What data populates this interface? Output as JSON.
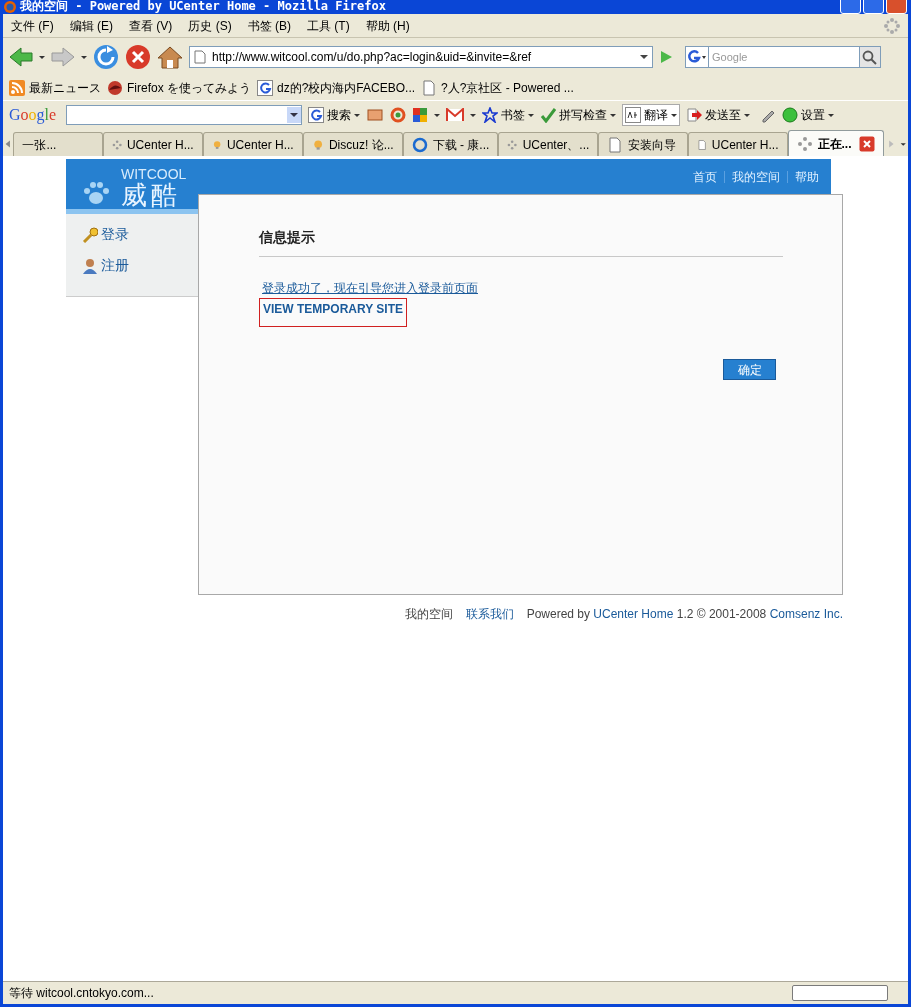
{
  "window": {
    "title": "我的空间 - Powered by UCenter Home - Mozilla Firefox"
  },
  "menu": [
    "文件 (F)",
    "编辑 (E)",
    "查看 (V)",
    "历史 (S)",
    "书签 (B)",
    "工具 (T)",
    "帮助 (H)"
  ],
  "nav": {
    "url": "http://www.witcool.com/u/do.php?ac=login&uid=&invite=&ref",
    "search_placeholder": "Google"
  },
  "bookmarks": [
    {
      "kind": "rss",
      "label": "最新ニュース"
    },
    {
      "kind": "firefox",
      "label": "Firefox を使ってみよう"
    },
    {
      "kind": "google",
      "label": "dz的?校内海内FACEBO..."
    },
    {
      "kind": "page",
      "label": "?人?京社区 - Powered ..."
    }
  ],
  "google_toolbar": {
    "logo": "Google",
    "buttons": [
      {
        "kind": "search",
        "label": "搜索"
      },
      {
        "kind": "bookmark",
        "label": "书签"
      },
      {
        "kind": "spell",
        "label": "拼写检查"
      },
      {
        "kind": "translate",
        "label": "翻译"
      },
      {
        "kind": "send",
        "label": "发送至"
      },
      {
        "kind": "settings",
        "label": "设置"
      }
    ]
  },
  "tabs": [
    {
      "label": "一张...",
      "selected": false,
      "kind": "plain"
    },
    {
      "label": "UCenter H...",
      "selected": false,
      "kind": "gear"
    },
    {
      "label": "UCenter H...",
      "selected": false,
      "kind": "bulb"
    },
    {
      "label": "Discuz! 论...",
      "selected": false,
      "kind": "bulb"
    },
    {
      "label": "下载 - 康...",
      "selected": false,
      "kind": "reload"
    },
    {
      "label": "UCenter、...",
      "selected": false,
      "kind": "gear"
    },
    {
      "label": "安装向导",
      "selected": false,
      "kind": "page"
    },
    {
      "label": "UCenter H...",
      "selected": false,
      "kind": "page"
    },
    {
      "label": "正在...",
      "selected": true,
      "kind": "gear"
    }
  ],
  "page": {
    "brand_en": "WITCOOL",
    "brand_cn": "威酷",
    "top_nav": [
      "首页",
      "我的空间",
      "帮助"
    ],
    "sidebar": [
      {
        "kind": "key",
        "label": "登录"
      },
      {
        "kind": "user",
        "label": "注册"
      }
    ],
    "message": {
      "title": "信息提示",
      "text": "登录成功了，现在引导您进入登录前页面",
      "link": "VIEW TEMPORARY SITE",
      "button": "确定"
    },
    "footer": [
      {
        "text": "我的空间",
        "kind": "text"
      },
      {
        "text": "联系我们",
        "kind": "link"
      }
    ],
    "powered": [
      {
        "text": "Powered by",
        "kind": "text"
      },
      {
        "text": "UCenter Home",
        "kind": "link"
      },
      {
        "text": "1.2 © 2001-2008",
        "kind": "text"
      },
      {
        "text": "Comsenz Inc.",
        "kind": "link"
      }
    ]
  },
  "status_bar": {
    "text": "等待 witcool.cntokyo.com..."
  }
}
